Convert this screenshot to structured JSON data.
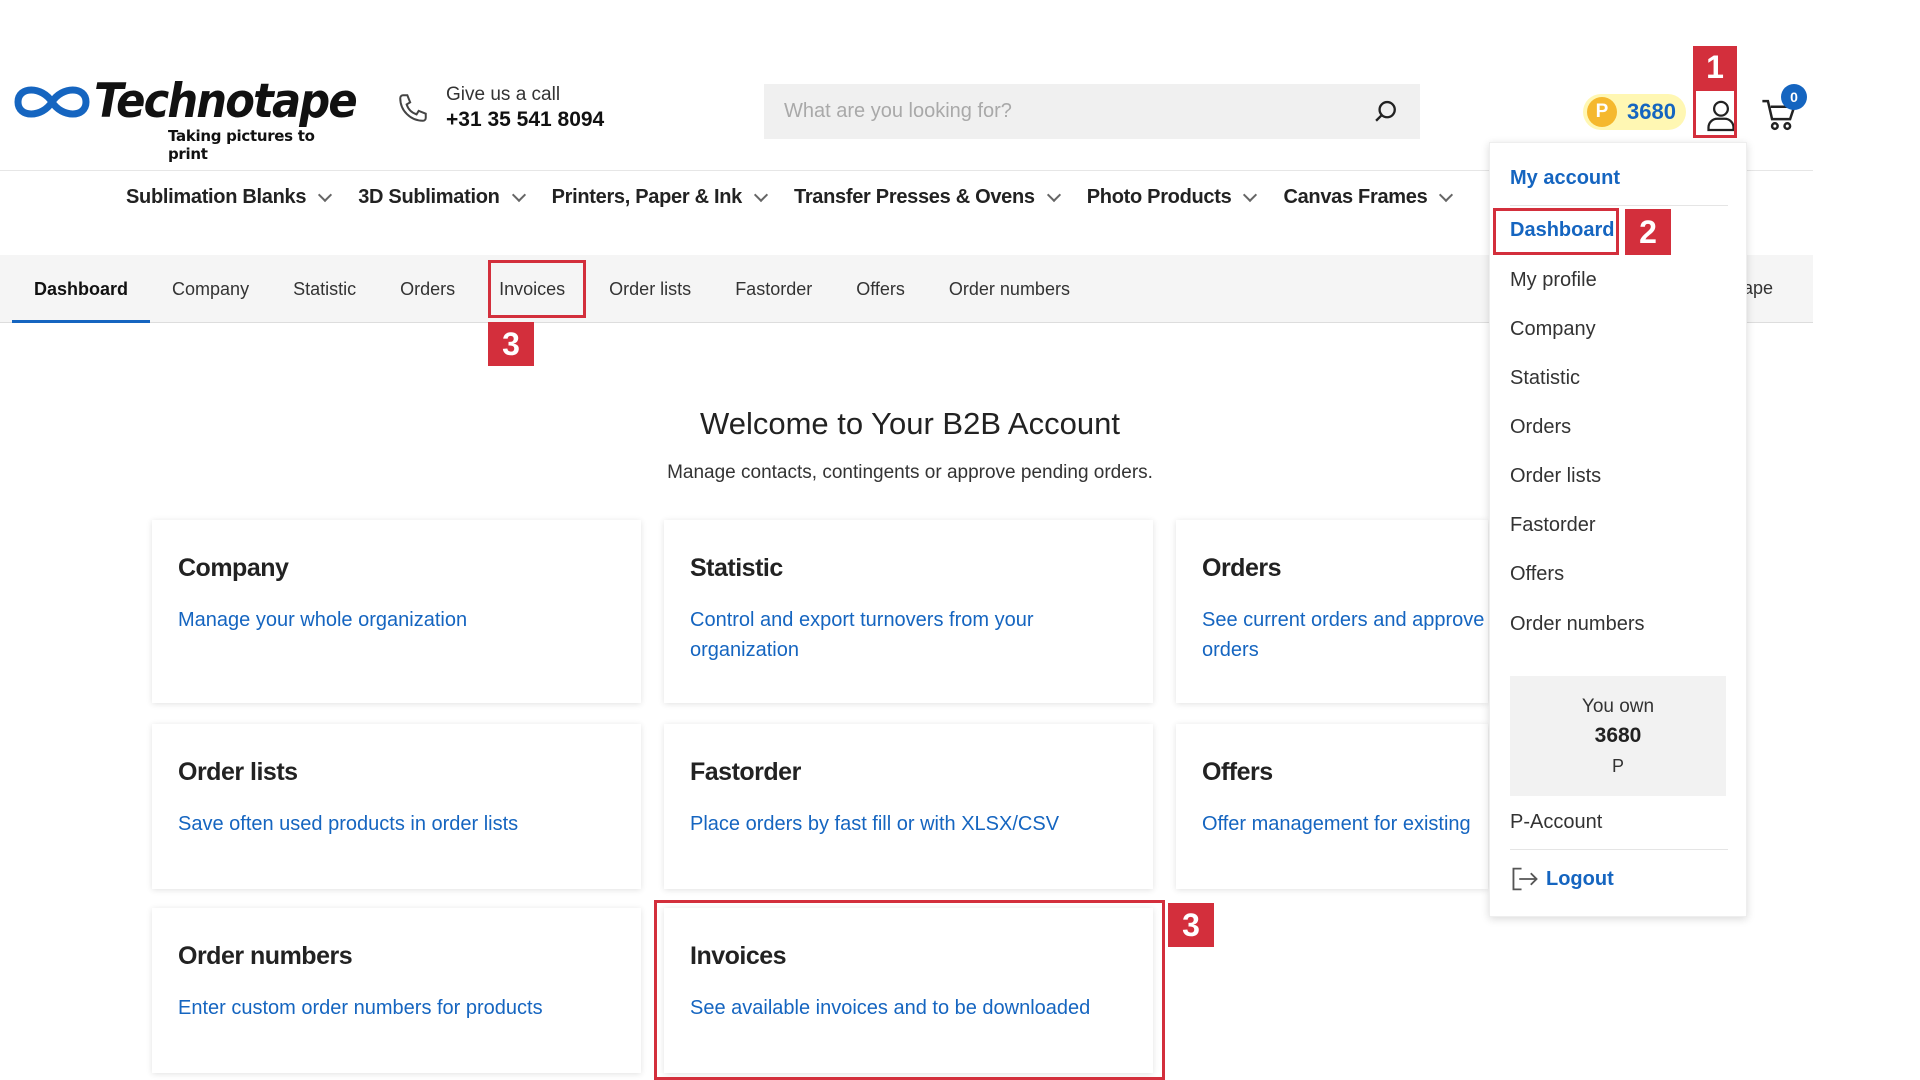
{
  "header": {
    "logo_name": "Technotape",
    "logo_tagline": "Taking pictures to print",
    "call_label": "Give us a call",
    "call_number": "+31 35 541 8094",
    "search_placeholder": "What are you looking for?",
    "points_badge": "P",
    "points_value": "3680",
    "cart_count": "0",
    "brand_color": "#1565c0"
  },
  "category_nav": [
    {
      "label": "Sublimation Blanks"
    },
    {
      "label": "3D Sublimation"
    },
    {
      "label": "Printers, Paper & Ink"
    },
    {
      "label": "Transfer Presses & Ovens"
    },
    {
      "label": "Photo Products"
    },
    {
      "label": "Canvas Frames"
    }
  ],
  "sub_nav": {
    "items": [
      "Dashboard",
      "Company",
      "Statistic",
      "Orders",
      "Invoices",
      "Order lists",
      "Fastorder",
      "Offers",
      "Order numbers"
    ],
    "active": "Dashboard",
    "tail": "tape"
  },
  "welcome": {
    "title": "Welcome to Your B2B Account",
    "subtitle": "Manage contacts, contingents or approve pending orders."
  },
  "cards": [
    {
      "title": "Company",
      "desc": "Manage your whole organization"
    },
    {
      "title": "Statistic",
      "desc": "Control and export turnovers from your organization"
    },
    {
      "title": "Orders",
      "desc": "See current orders and approve orders"
    },
    {
      "title": "Order lists",
      "desc": "Save often used products in order lists"
    },
    {
      "title": "Fastorder",
      "desc": "Place orders by fast fill or with XLSX/CSV"
    },
    {
      "title": "Offers",
      "desc": "Offer management for existing"
    },
    {
      "title": "Order numbers",
      "desc": "Enter custom order numbers for products"
    },
    {
      "title": "Invoices",
      "desc": "See available invoices and to be downloaded"
    }
  ],
  "account_menu": {
    "heading": "My account",
    "items": [
      "Dashboard",
      "My profile",
      "Company",
      "Statistic",
      "Orders",
      "Order lists",
      "Fastorder",
      "Offers",
      "Order numbers"
    ],
    "active": "Dashboard",
    "own_label": "You own",
    "own_value": "3680",
    "own_unit": "P",
    "p_account": "P-Account",
    "logout": "Logout"
  },
  "annotations": {
    "step1": "1",
    "step2": "2",
    "step3": "3",
    "color": "#d32f3c"
  }
}
